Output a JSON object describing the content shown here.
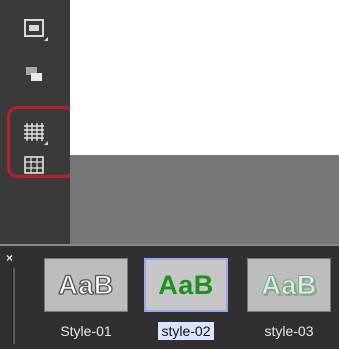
{
  "toolbar": {
    "buttons": [
      {
        "icon": "safe-area-icon"
      },
      {
        "icon": "overlay-icon"
      },
      {
        "icon": "grid-icon"
      },
      {
        "icon": "grid-frame-icon"
      }
    ],
    "highlight_color": "#b8202d"
  },
  "palette": {
    "close_glyph": "×",
    "styles": [
      {
        "name": "Style-01",
        "preview": "AaB",
        "fill": "#ffffff",
        "outline": "#555555"
      },
      {
        "name": "style-02",
        "preview": "AaB",
        "fill": "#1f8f1f",
        "selected": true
      },
      {
        "name": "style-03",
        "preview": "AaB",
        "fill": "#d9efe6",
        "shadow": "#8fa696"
      }
    ]
  }
}
